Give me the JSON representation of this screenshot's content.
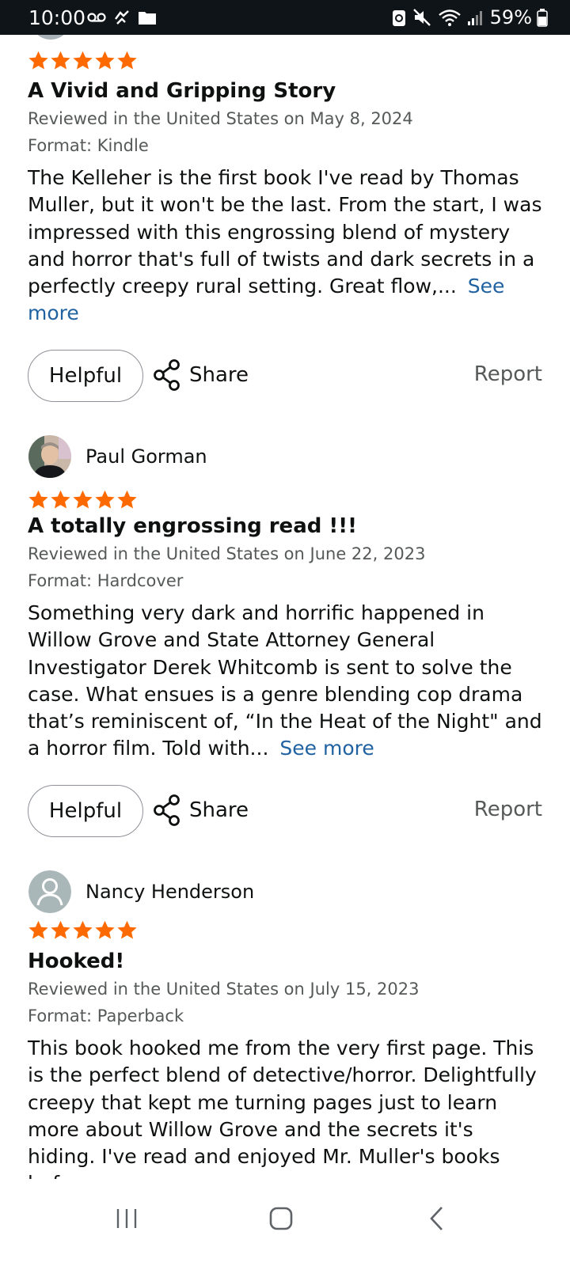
{
  "status_bar": {
    "time": "10:00",
    "battery": "59%"
  },
  "reviews": [
    {
      "reviewer": "",
      "rating": 5,
      "title": "A Vivid and Gripping Story",
      "date_line": "Reviewed in the United States on May 8, 2024",
      "format": "Format: Kindle",
      "body": "The Kelleher is the first book I've read by Thomas Muller, but it won't be the last. From the start, I was impressed with this engrossing blend of mystery and horror that's full of twists and dark secrets in a perfectly creepy rural setting. Great flow,...",
      "see_more": "See more"
    },
    {
      "reviewer": "Paul Gorman",
      "rating": 5,
      "title": "A totally engrossing read !!!",
      "date_line": "Reviewed in the United States on June 22, 2023",
      "format": "Format: Hardcover",
      "body": "Something very dark and horrific happened in Willow Grove and State Attorney General Investigator Derek Whitcomb is sent to solve the case. What ensues is a genre blending cop drama that’s reminiscent of, “In the Heat of the Night\" and a horror film. Told with...",
      "see_more": "See more"
    },
    {
      "reviewer": "Nancy Henderson",
      "rating": 5,
      "title": "Hooked!",
      "date_line": "Reviewed in the United States on July 15, 2023",
      "format": "Format: Paperback",
      "body": "This book hooked me from the very first page. This is the perfect blend of detective/horror. Delightfully creepy that kept me turning pages just to learn more about Willow Grove and the secrets it's hiding. I've read and enjoyed Mr. Muller's books before",
      "see_more": ""
    }
  ],
  "actions": {
    "helpful": "Helpful",
    "share": "Share",
    "report": "Report"
  },
  "colors": {
    "star": "#ff6a00",
    "link": "#2162a1",
    "muted": "#565959",
    "statusbar": "#0f1419"
  },
  "icons": {
    "share": "share-icon",
    "nav_recents": "recents-icon",
    "nav_home": "home-icon",
    "nav_back": "back-icon"
  }
}
